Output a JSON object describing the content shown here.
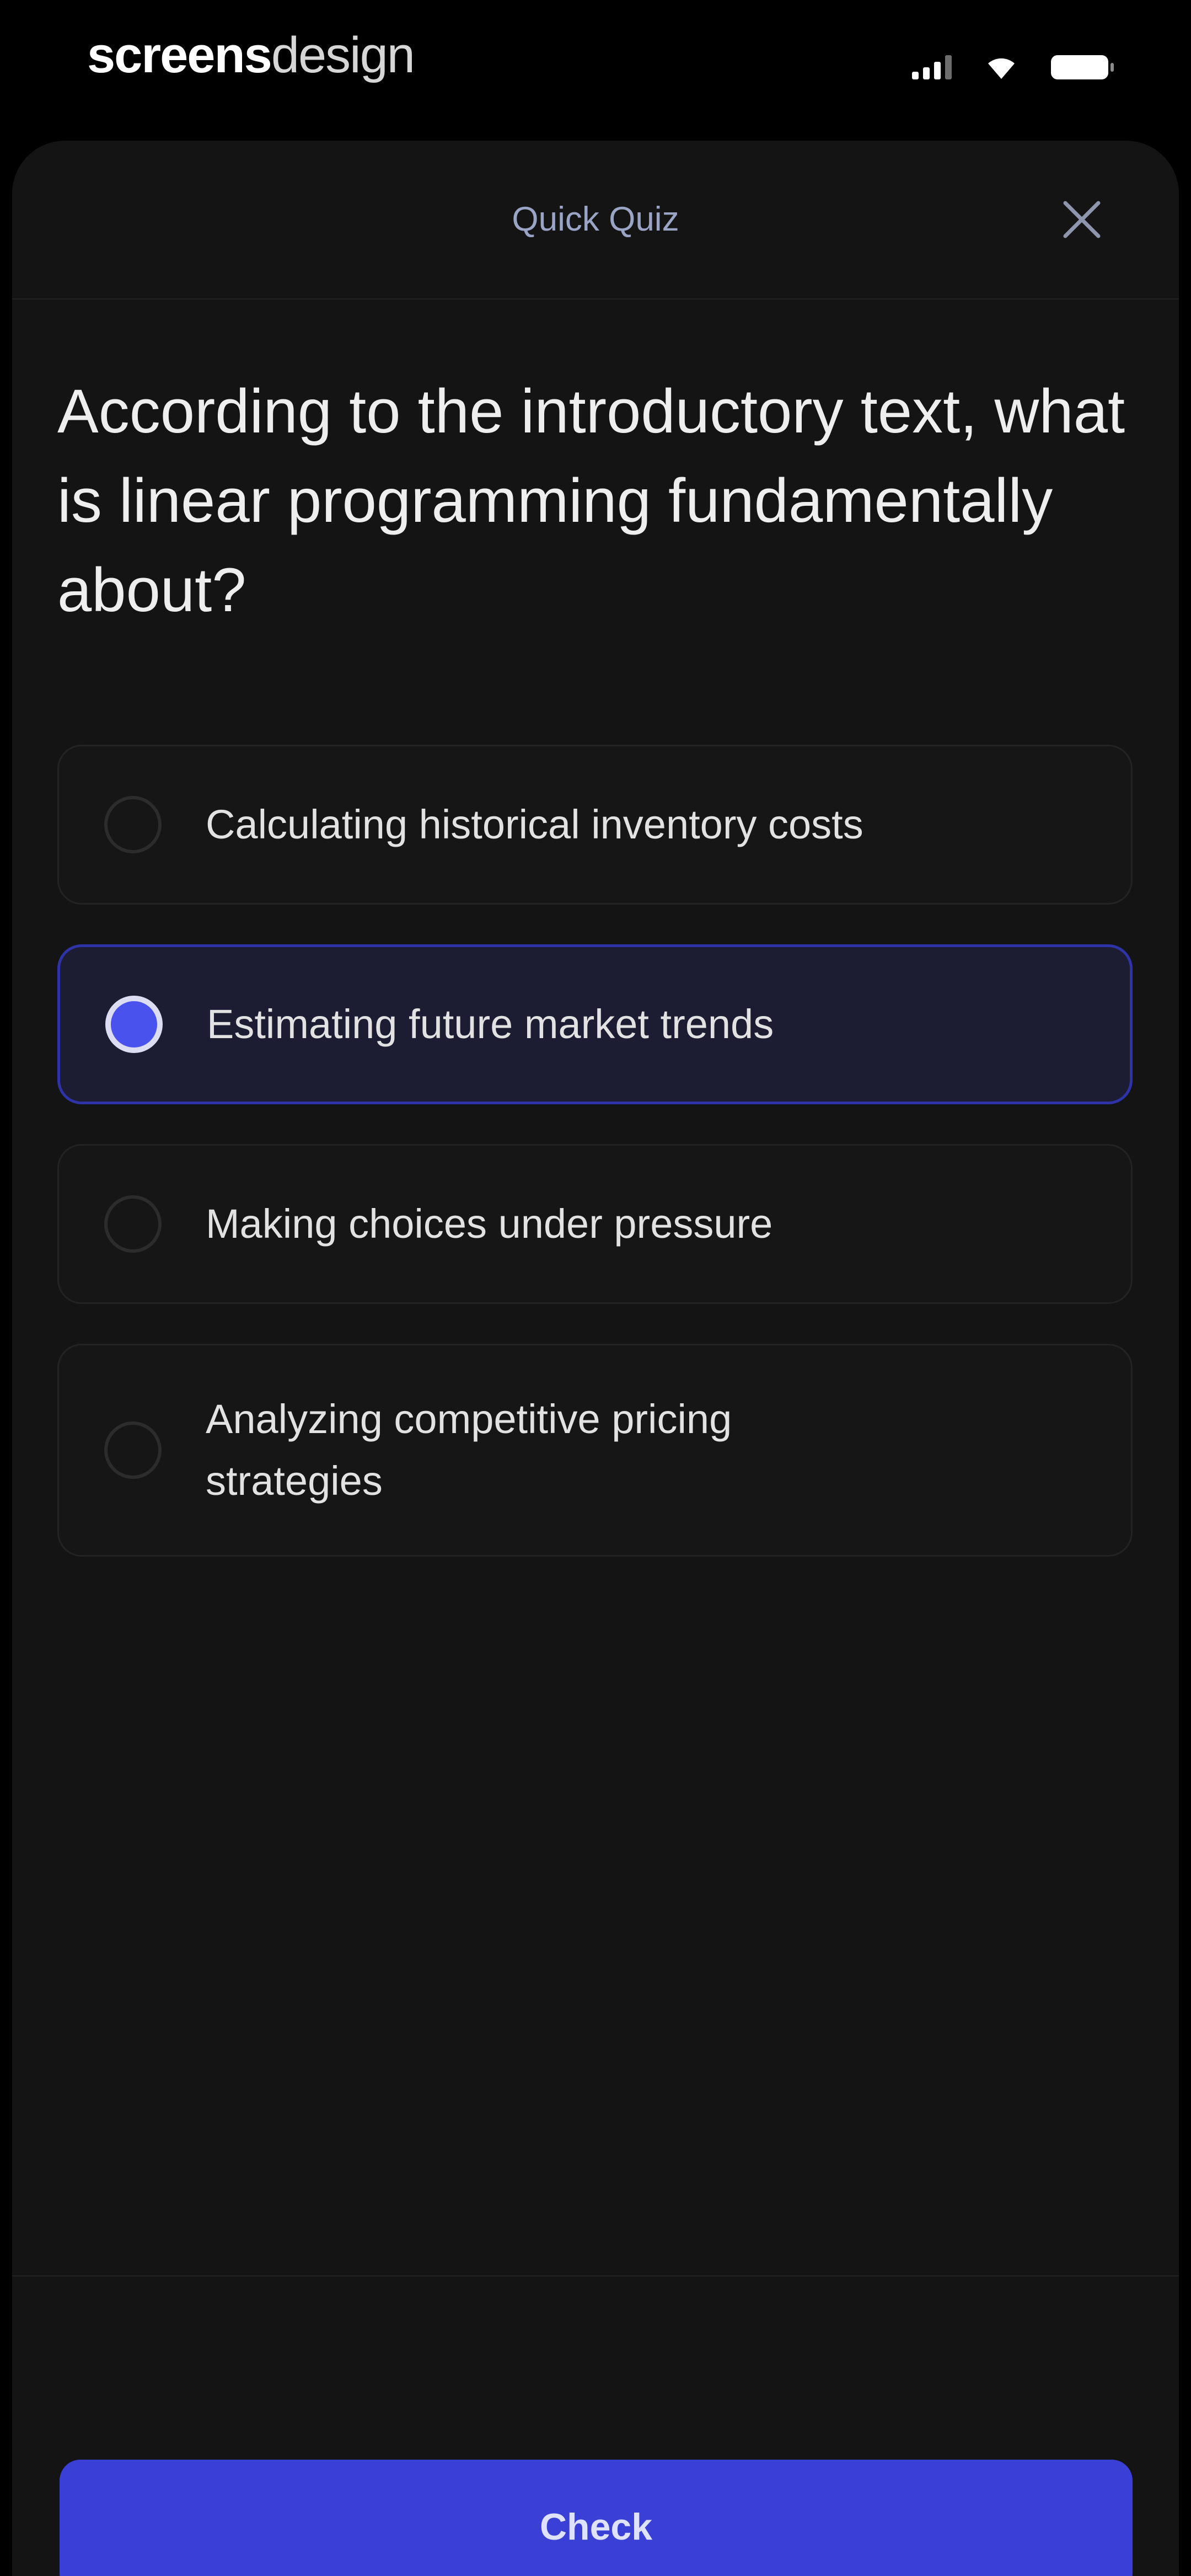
{
  "status_bar": {
    "brand_bold": "screens",
    "brand_light": "design",
    "icons": [
      "signal-icon",
      "wifi-icon",
      "battery-icon"
    ]
  },
  "sheet": {
    "title": "Quick Quiz",
    "close_icon": "close-icon"
  },
  "question": "According to the introductory text, what is linear programming fundamentally about?",
  "options": [
    {
      "label": "Calculating historical inventory costs",
      "selected": false
    },
    {
      "label": "Estimating future market trends",
      "selected": true
    },
    {
      "label": "Making choices under pressure",
      "selected": false
    },
    {
      "label": "Analyzing competitive pricing strategies",
      "selected": false
    }
  ],
  "footer": {
    "check_label": "Check"
  },
  "colors": {
    "background": "#000000",
    "sheet": "#141414",
    "accent": "#3a3fd6",
    "selected_option_bg": "#1c1d33",
    "selected_radio": "#4a52ee",
    "title_text": "#9aa5c6"
  }
}
